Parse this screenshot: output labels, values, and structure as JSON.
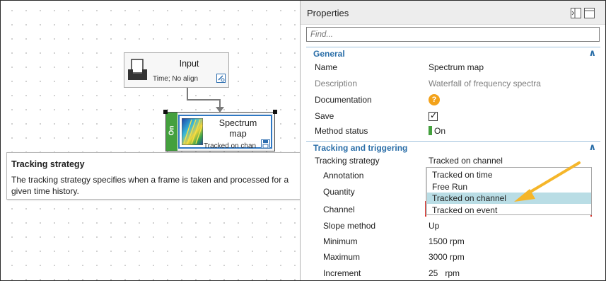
{
  "canvas": {
    "input_node": {
      "title": "Input",
      "subtitle": "Time; No align"
    },
    "spectrum_node": {
      "status": "On",
      "title_line1": "Spectrum",
      "title_line2": "map",
      "subtitle": "Tracked on chan"
    },
    "tooltip": {
      "title": "Tracking strategy",
      "body": "The tracking strategy specifies when a frame is taken and processed for a given time history."
    }
  },
  "properties": {
    "title": "Properties",
    "find_placeholder": "Find...",
    "sections": {
      "general": {
        "label": "General",
        "rows": {
          "name": {
            "key": "Name",
            "value": "Spectrum map"
          },
          "description": {
            "key": "Description",
            "value": "Waterfall of frequency spectra"
          },
          "documentation": {
            "key": "Documentation",
            "value": "?"
          },
          "save": {
            "key": "Save",
            "checked": true
          },
          "method_status": {
            "key": "Method status",
            "value": "On"
          }
        }
      },
      "tracking": {
        "label": "Tracking and triggering",
        "rows": {
          "tracking_strategy": {
            "key": "Tracking strategy",
            "value": "Tracked on channel"
          },
          "annotation": {
            "key": "Annotation"
          },
          "quantity": {
            "key": "Quantity"
          },
          "channel": {
            "key": "Channel"
          },
          "slope_method": {
            "key": "Slope method",
            "value": "Up"
          },
          "minimum": {
            "key": "Minimum",
            "value": "1500 rpm"
          },
          "maximum": {
            "key": "Maximum",
            "value": "3000 rpm"
          },
          "increment": {
            "key": "Increment",
            "value": "25   rpm"
          }
        }
      }
    },
    "dropdown": {
      "options": [
        "Tracked on time",
        "Free Run",
        "Tracked on channel",
        "Tracked on event"
      ],
      "highlighted": "Tracked on channel"
    }
  },
  "colors": {
    "section_blue": "#2a6ea8",
    "on_green": "#44a03e",
    "tooltip_bar": "#f6b418",
    "highlight": "#b9dde5",
    "arrow": "#f5b62a"
  },
  "icons": [
    "input-tray-icon",
    "node-config-icon",
    "spectrum-thumbnail-icon",
    "save-disk-icon",
    "help-icon",
    "checkbox-icon",
    "collapse-chevron-icon",
    "panel-dock-icon",
    "panel-window-icon"
  ]
}
